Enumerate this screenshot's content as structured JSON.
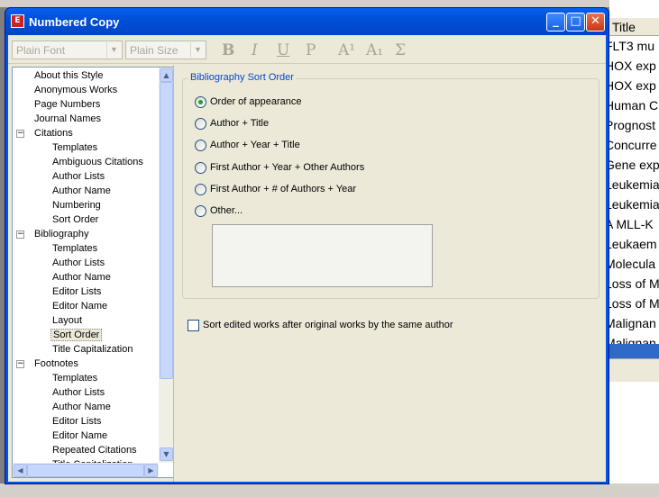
{
  "window": {
    "title": "Numbered Copy"
  },
  "toolbar": {
    "font_value": "Plain Font",
    "size_value": "Plain Size",
    "bold": "B",
    "italic": "I",
    "underline": "U",
    "plain": "P",
    "superscript": "A¹",
    "subscript": "A₁",
    "sigma": "Σ"
  },
  "tree": [
    {
      "label": "About this Style",
      "level": 0
    },
    {
      "label": "Anonymous Works",
      "level": 0
    },
    {
      "label": "Page Numbers",
      "level": 0
    },
    {
      "label": "Journal Names",
      "level": 0
    },
    {
      "label": "Citations",
      "level": 0,
      "expander": "−"
    },
    {
      "label": "Templates",
      "level": 1
    },
    {
      "label": "Ambiguous Citations",
      "level": 1
    },
    {
      "label": "Author Lists",
      "level": 1
    },
    {
      "label": "Author Name",
      "level": 1
    },
    {
      "label": "Numbering",
      "level": 1
    },
    {
      "label": "Sort Order",
      "level": 1
    },
    {
      "label": "Bibliography",
      "level": 0,
      "expander": "−"
    },
    {
      "label": "Templates",
      "level": 1
    },
    {
      "label": "Author Lists",
      "level": 1
    },
    {
      "label": "Author Name",
      "level": 1
    },
    {
      "label": "Editor Lists",
      "level": 1
    },
    {
      "label": "Editor Name",
      "level": 1
    },
    {
      "label": "Layout",
      "level": 1
    },
    {
      "label": "Sort Order",
      "level": 1,
      "selected": true
    },
    {
      "label": "Title Capitalization",
      "level": 1
    },
    {
      "label": "Footnotes",
      "level": 0,
      "expander": "−"
    },
    {
      "label": "Templates",
      "level": 1
    },
    {
      "label": "Author Lists",
      "level": 1
    },
    {
      "label": "Author Name",
      "level": 1
    },
    {
      "label": "Editor Lists",
      "level": 1
    },
    {
      "label": "Editor Name",
      "level": 1
    },
    {
      "label": "Repeated Citations",
      "level": 1
    },
    {
      "label": "Title Capitalization",
      "level": 1
    }
  ],
  "sort_order": {
    "group_title": "Bibliography Sort Order",
    "options": [
      {
        "label": "Order of appearance",
        "checked": true
      },
      {
        "label": "Author + Title",
        "checked": false
      },
      {
        "label": "Author + Year + Title",
        "checked": false
      },
      {
        "label": "First Author + Year + Other Authors",
        "checked": false
      },
      {
        "label": "First Author + # of Authors + Year",
        "checked": false
      },
      {
        "label": "Other...",
        "checked": false
      }
    ],
    "checkbox_label": "Sort edited works after original works by the same author",
    "checkbox_checked": false
  },
  "background": {
    "column_header": "Title",
    "rows": [
      "FLT3 mu",
      "HOX exp",
      "HOX exp",
      "Human C",
      "Prognost",
      "Concurre",
      "Gene exp",
      "Leukemia",
      "Leukemia",
      "A MLL-K",
      "Leukaem",
      "Molecula",
      "Loss of M",
      "Loss of M",
      "Malignan",
      "Malignan"
    ]
  }
}
